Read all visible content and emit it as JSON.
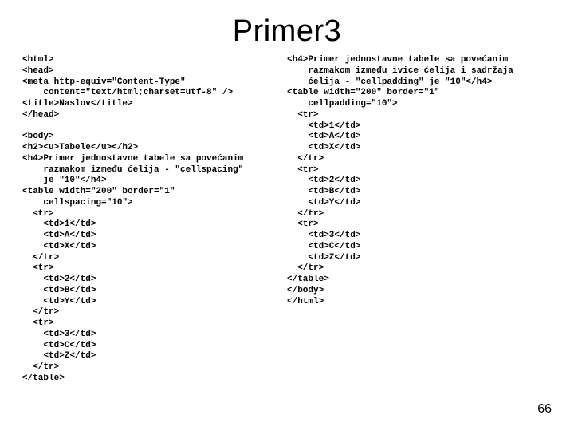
{
  "title": "Primer3",
  "left_code": "<html>\n<head>\n<meta http-equiv=\"Content-Type\"\n    content=\"text/html;charset=utf-8\" />\n<title>Naslov</title>\n</head>\n\n<body>\n<h2><u>Tabele</u></h2>\n<h4>Primer jednostavne tabele sa povećanim\n    razmakom između ćelija - \"cellspacing\"\n    je \"10\"</h4>\n<table width=\"200\" border=\"1\"\n    cellspacing=\"10\">\n  <tr>\n    <td>1</td>\n    <td>A</td>\n    <td>X</td>\n  </tr>\n  <tr>\n    <td>2</td>\n    <td>B</td>\n    <td>Y</td>\n  </tr>\n  <tr>\n    <td>3</td>\n    <td>C</td>\n    <td>Z</td>\n  </tr>\n</table>",
  "right_code": "<h4>Primer jednostavne tabele sa povećanim\n    razmakom između ivice ćelija i sadržaja\n    ćelija - \"cellpadding\" je \"10\"</h4>\n<table width=\"200\" border=\"1\"\n    cellpadding=\"10\">\n  <tr>\n    <td>1</td>\n    <td>A</td>\n    <td>X</td>\n  </tr>\n  <tr>\n    <td>2</td>\n    <td>B</td>\n    <td>Y</td>\n  </tr>\n  <tr>\n    <td>3</td>\n    <td>C</td>\n    <td>Z</td>\n  </tr>\n</table>\n</body>\n</html>",
  "page_number": "66"
}
